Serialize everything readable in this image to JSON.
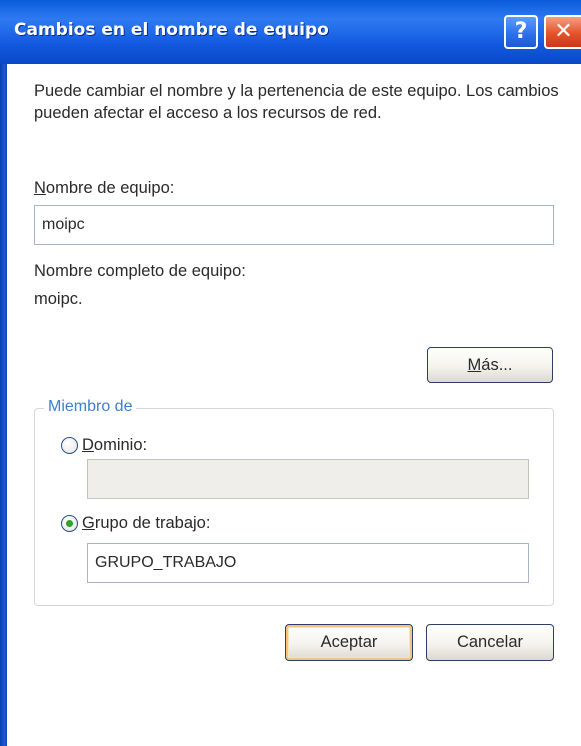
{
  "window": {
    "title": "Cambios en el nombre de equipo",
    "help_symbol": "?",
    "close_symbol": "✕"
  },
  "description": "Puede cambiar el nombre y la pertenencia de este equipo. Los cambios pueden afectar el acceso a los recursos de red.",
  "computer_name": {
    "label_mnemonic": "N",
    "label_rest": "ombre de equipo:",
    "value": "moipc"
  },
  "full_name": {
    "label": "Nombre completo de equipo:",
    "value": "moipc."
  },
  "more_button": {
    "mnemonic": "M",
    "rest": "ás..."
  },
  "member_of": {
    "legend": "Miembro de",
    "domain": {
      "label_mnemonic": "D",
      "label_rest": "ominio:",
      "value": "",
      "selected": false
    },
    "workgroup": {
      "label_mnemonic": "G",
      "label_rest": "rupo de trabajo:",
      "value": "GRUPO_TRABAJO",
      "selected": true
    }
  },
  "buttons": {
    "ok": "Aceptar",
    "cancel": "Cancelar"
  },
  "colors": {
    "titlebar": "#0a5bdb",
    "group_legend": "#3c7fd4",
    "radio_selected": "#2fa032",
    "close_button": "#e5532a"
  }
}
